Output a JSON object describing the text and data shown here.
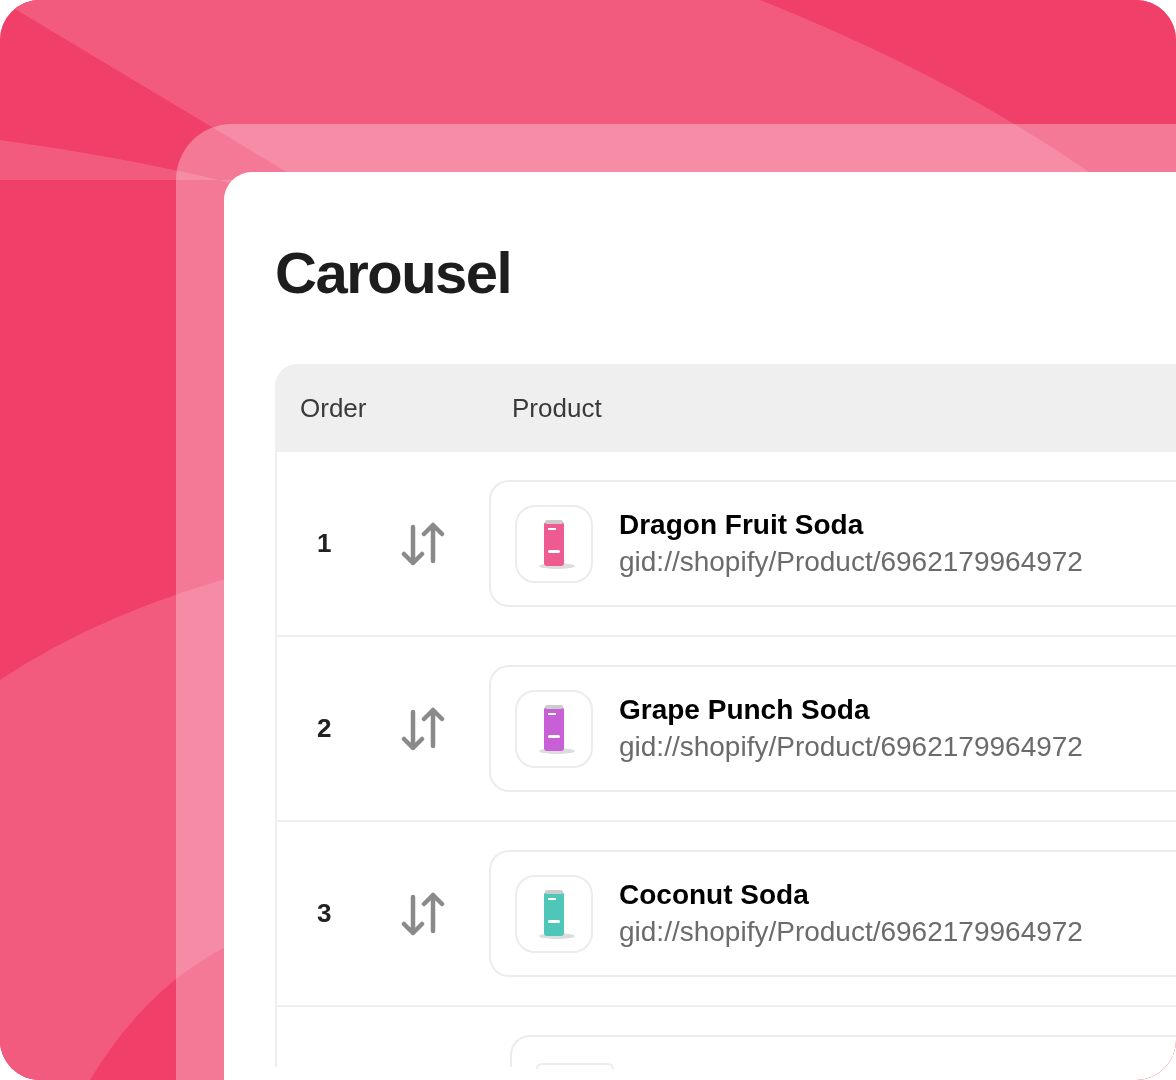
{
  "title": "Carousel",
  "table": {
    "columns": [
      "Order",
      "Product"
    ],
    "rows": [
      {
        "order": "1",
        "name": "Dragon Fruit Soda",
        "gid": "gid://shopify/Product/6962179964972",
        "color": "#ee5a92"
      },
      {
        "order": "2",
        "name": "Grape Punch Soda",
        "gid": "gid://shopify/Product/6962179964972",
        "color": "#c95fd6"
      },
      {
        "order": "3",
        "name": "Coconut Soda",
        "gid": "gid://shopify/Product/6962179964972",
        "color": "#4fc7b8"
      }
    ],
    "more_rows_below": true
  }
}
